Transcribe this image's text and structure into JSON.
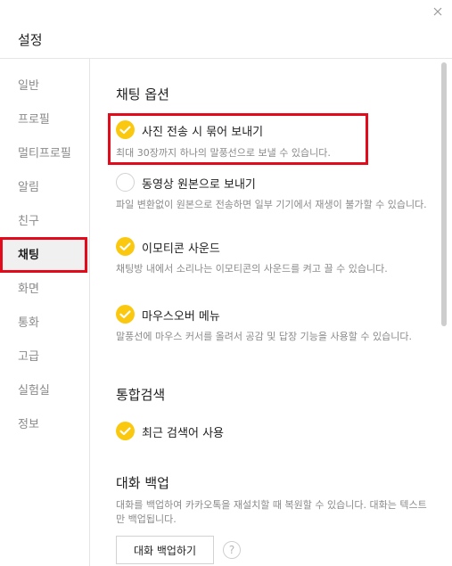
{
  "window": {
    "title": "설정",
    "close_glyph": "✕"
  },
  "sidebar": {
    "items": [
      {
        "label": "일반",
        "active": false
      },
      {
        "label": "프로필",
        "active": false
      },
      {
        "label": "멀티프로필",
        "active": false
      },
      {
        "label": "알림",
        "active": false
      },
      {
        "label": "친구",
        "active": false
      },
      {
        "label": "채팅",
        "active": true
      },
      {
        "label": "화면",
        "active": false
      },
      {
        "label": "통화",
        "active": false
      },
      {
        "label": "고급",
        "active": false
      },
      {
        "label": "실험실",
        "active": false
      },
      {
        "label": "정보",
        "active": false
      }
    ]
  },
  "chat_options": {
    "title": "채팅 옵션",
    "options": [
      {
        "label": "사진 전송 시 묶어 보내기",
        "checked": true,
        "desc": "최대 30장까지 하나의 말풍선으로 보낼 수 있습니다."
      },
      {
        "label": "동영상 원본으로 보내기",
        "checked": false,
        "desc": "파일 변환없이 원본으로 전송하면 일부 기기에서 재생이 불가할 수 있습니다."
      },
      {
        "label": "이모티콘 사운드",
        "checked": true,
        "desc": "채팅방 내에서 소리나는 이모티콘의 사운드를 켜고 끌 수 있습니다."
      },
      {
        "label": "마우스오버 메뉴",
        "checked": true,
        "desc": "말풍선에 마우스 커서를 올려서 공감 및 답장 기능을 사용할 수 있습니다."
      }
    ]
  },
  "integrated_search": {
    "title": "통합검색",
    "option": {
      "label": "최근 검색어 사용",
      "checked": true
    }
  },
  "backup": {
    "title": "대화 백업",
    "desc": "대화를 백업하여 카카오톡을 재설치할 때 복원할 수 있습니다. 대화는 텍스트만 백업됩니다.",
    "button_label": "대화 백업하기",
    "help_glyph": "?"
  },
  "colors": {
    "accent": "#fbc810",
    "highlight": "#e30a1c",
    "muted": "#8a8a8a"
  }
}
